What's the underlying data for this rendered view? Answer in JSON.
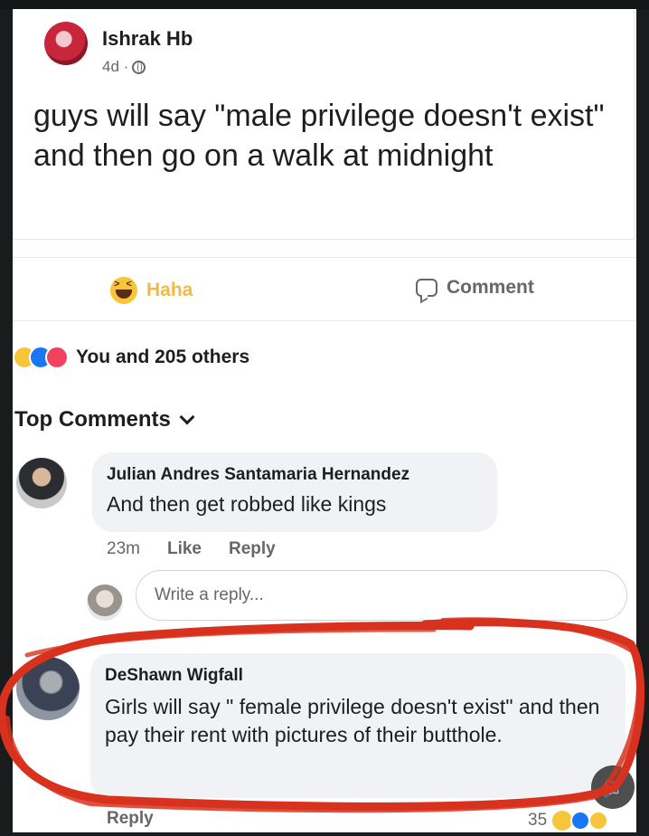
{
  "post": {
    "author": "Ishrak Hb",
    "time": "4d ·",
    "privacy_icon": "globe-icon",
    "text": "guys will say \"male privilege doesn't exist\" and then go on a walk at midnight"
  },
  "actions": {
    "haha_label": "Haha",
    "comment_label": "Comment"
  },
  "reactions": {
    "icons": [
      "haha-icon",
      "like-icon",
      "wow-icon"
    ],
    "summary": "You and 205 others"
  },
  "comments_section": {
    "heading": "Top Comments"
  },
  "comments": [
    {
      "name": "Julian Andres Santamaria Hernandez",
      "text": "And then get robbed like kings",
      "time": "23m",
      "like": "Like",
      "reply": "Reply"
    },
    {
      "name": "DeShawn Wigfall",
      "text": "Girls will say \" female privilege doesn't exist\" and then pay their rent with pictures of their butthole.",
      "reply": "Reply",
      "reaction_count": "35"
    }
  ],
  "reply_box": {
    "placeholder": "Write a reply..."
  },
  "colors": {
    "haha": "#f2b94a",
    "annotation_red": "#d8321e",
    "link_gray": "#65676b"
  }
}
